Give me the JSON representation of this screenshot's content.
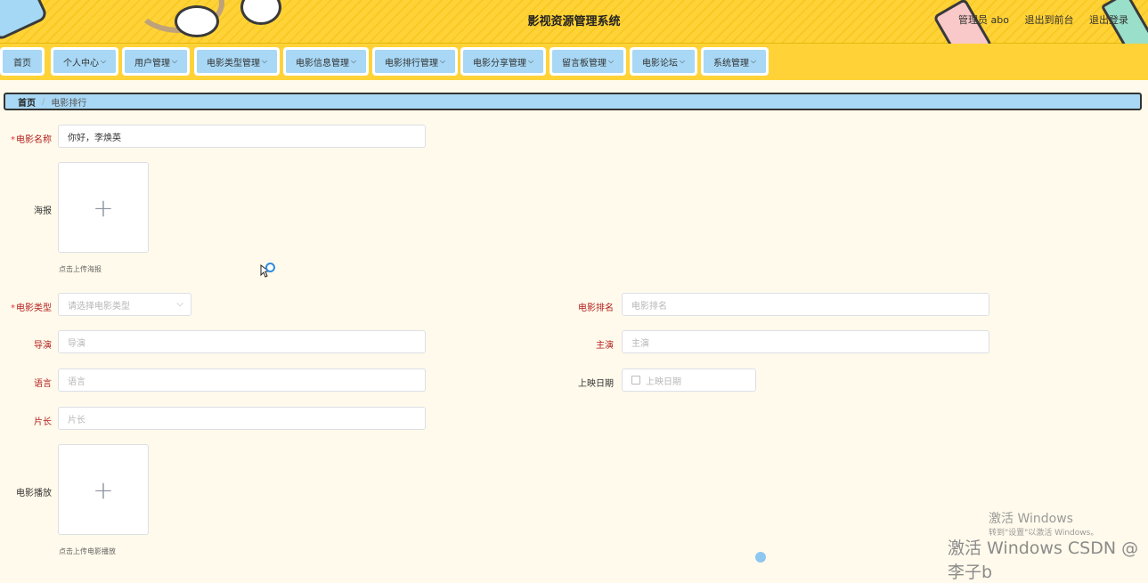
{
  "header": {
    "title": "影视资源管理系统",
    "user_label": "管理员 abo",
    "goto_front_label": "退出到前台",
    "logout_label": "退出登录"
  },
  "nav": [
    {
      "label": "首页",
      "has_dropdown": false
    },
    {
      "label": "个人中心",
      "has_dropdown": true
    },
    {
      "label": "用户管理",
      "has_dropdown": true
    },
    {
      "label": "电影类型管理",
      "has_dropdown": true
    },
    {
      "label": "电影信息管理",
      "has_dropdown": true
    },
    {
      "label": "电影排行管理",
      "has_dropdown": true
    },
    {
      "label": "电影分享管理",
      "has_dropdown": true
    },
    {
      "label": "留言板管理",
      "has_dropdown": true
    },
    {
      "label": "电影论坛",
      "has_dropdown": true
    },
    {
      "label": "系统管理",
      "has_dropdown": true
    }
  ],
  "breadcrumb": {
    "home": "首页",
    "separator": "/",
    "current": "电影排行"
  },
  "form": {
    "movie_name": {
      "label": "电影名称",
      "required": true,
      "value": "你好，李焕英"
    },
    "poster": {
      "label": "海报",
      "hint": "点击上传海报"
    },
    "movie_type": {
      "label": "电影类型",
      "required": true,
      "placeholder": "请选择电影类型"
    },
    "movie_rank": {
      "label": "电影排名",
      "placeholder": "电影排名"
    },
    "director": {
      "label": "导演",
      "placeholder": "导演"
    },
    "actor": {
      "label": "主演",
      "placeholder": "主演"
    },
    "language": {
      "label": "语言",
      "placeholder": "语言"
    },
    "release_date": {
      "label": "上映日期",
      "placeholder": "上映日期"
    },
    "duration": {
      "label": "片长",
      "placeholder": "片长"
    },
    "movie_play": {
      "label": "电影播放",
      "hint": "点击上传电影播放"
    }
  },
  "icons": {
    "upload": "+",
    "dropdown": "⌵"
  },
  "watermark": {
    "line1": "激活 Windows",
    "line2": "转到\"设置\"以激活 Windows。",
    "line3": "激活 Windows  CSDN @李子b"
  },
  "colors": {
    "header_bg": "#ffd338",
    "nav_item_bg": "#a8d8f5",
    "page_bg": "#fffaeb",
    "label_red": "#b31e1e"
  }
}
